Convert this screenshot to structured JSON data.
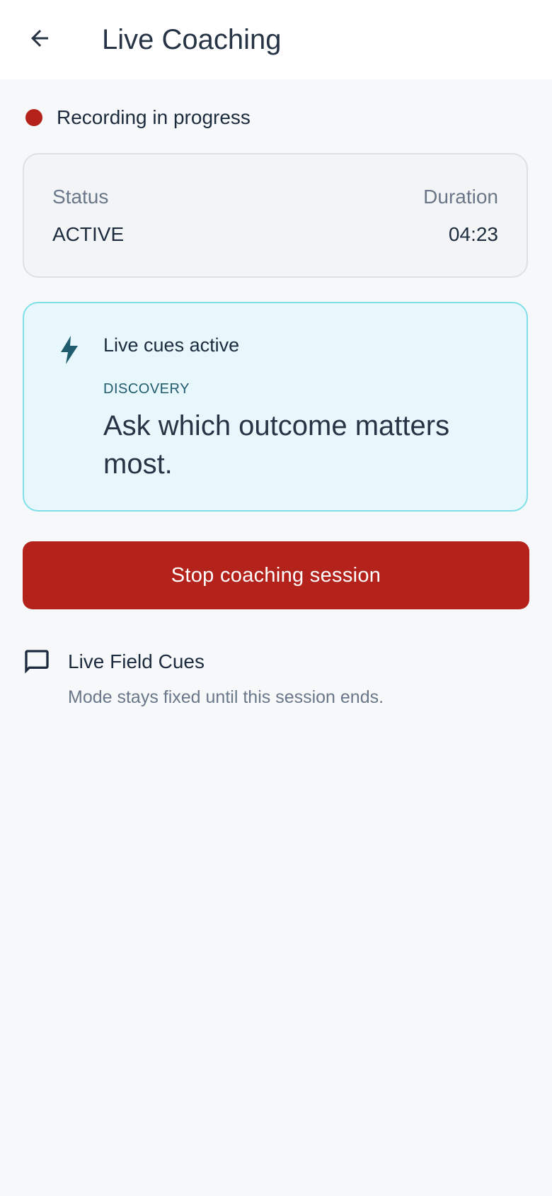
{
  "header": {
    "title": "Live Coaching",
    "back_icon": "arrow-left-icon"
  },
  "recording": {
    "text": "Recording in progress",
    "dot_color": "#b52219"
  },
  "status_card": {
    "status_label": "Status",
    "status_value": "ACTIVE",
    "duration_label": "Duration",
    "duration_value": "04:23"
  },
  "cue_card": {
    "icon": "bolt-icon",
    "heading": "Live cues active",
    "category": "DISCOVERY",
    "cue": "Ask which outcome matters most.",
    "accent": "#1f5c6d",
    "border": "#7fe0ea",
    "background": "#e8f7fb"
  },
  "stop_button": {
    "label": "Stop coaching session",
    "color": "#b3231b"
  },
  "field_cues": {
    "icon": "chat-bubble-icon",
    "title": "Live Field Cues",
    "subtitle": "Mode stays fixed until this session ends."
  }
}
